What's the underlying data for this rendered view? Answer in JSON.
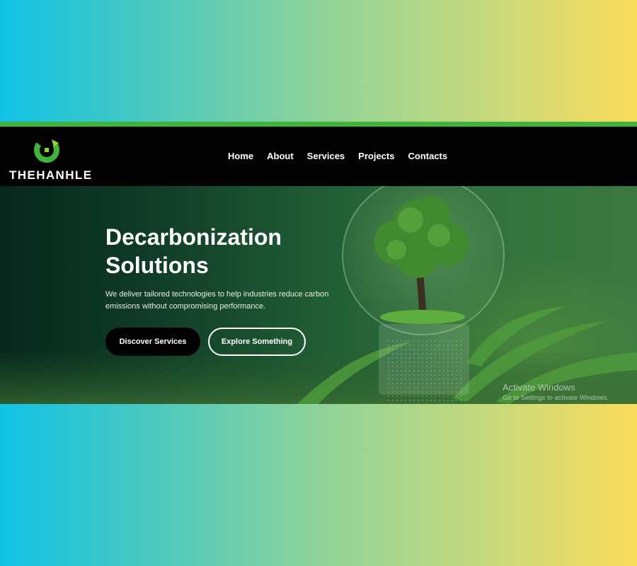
{
  "brand": {
    "name": "THEHANHLE",
    "logo_icon": "recycle-arrow-icon",
    "accent_green": "#3fb33b",
    "accent_lime": "#9bd12e"
  },
  "nav": {
    "items": [
      {
        "label": "Home"
      },
      {
        "label": "About"
      },
      {
        "label": "Services"
      },
      {
        "label": "Projects"
      },
      {
        "label": "Contacts"
      }
    ]
  },
  "hero": {
    "title": "Decarbonization\nSolutions",
    "description": "We deliver tailored technologies to help industries reduce carbon emissions without compromising performance.",
    "primary_button": "Discover Services",
    "secondary_button": "Explore Something",
    "image_icon": "tree-in-lightbulb-illustration"
  },
  "watermark": {
    "title": "Activate Windows",
    "subtitle": "Go to Settings to activate Windows."
  },
  "colors": {
    "navbar_bg": "#020302",
    "background_gradient": [
      "#10c3e6",
      "#fbdc5b"
    ]
  }
}
